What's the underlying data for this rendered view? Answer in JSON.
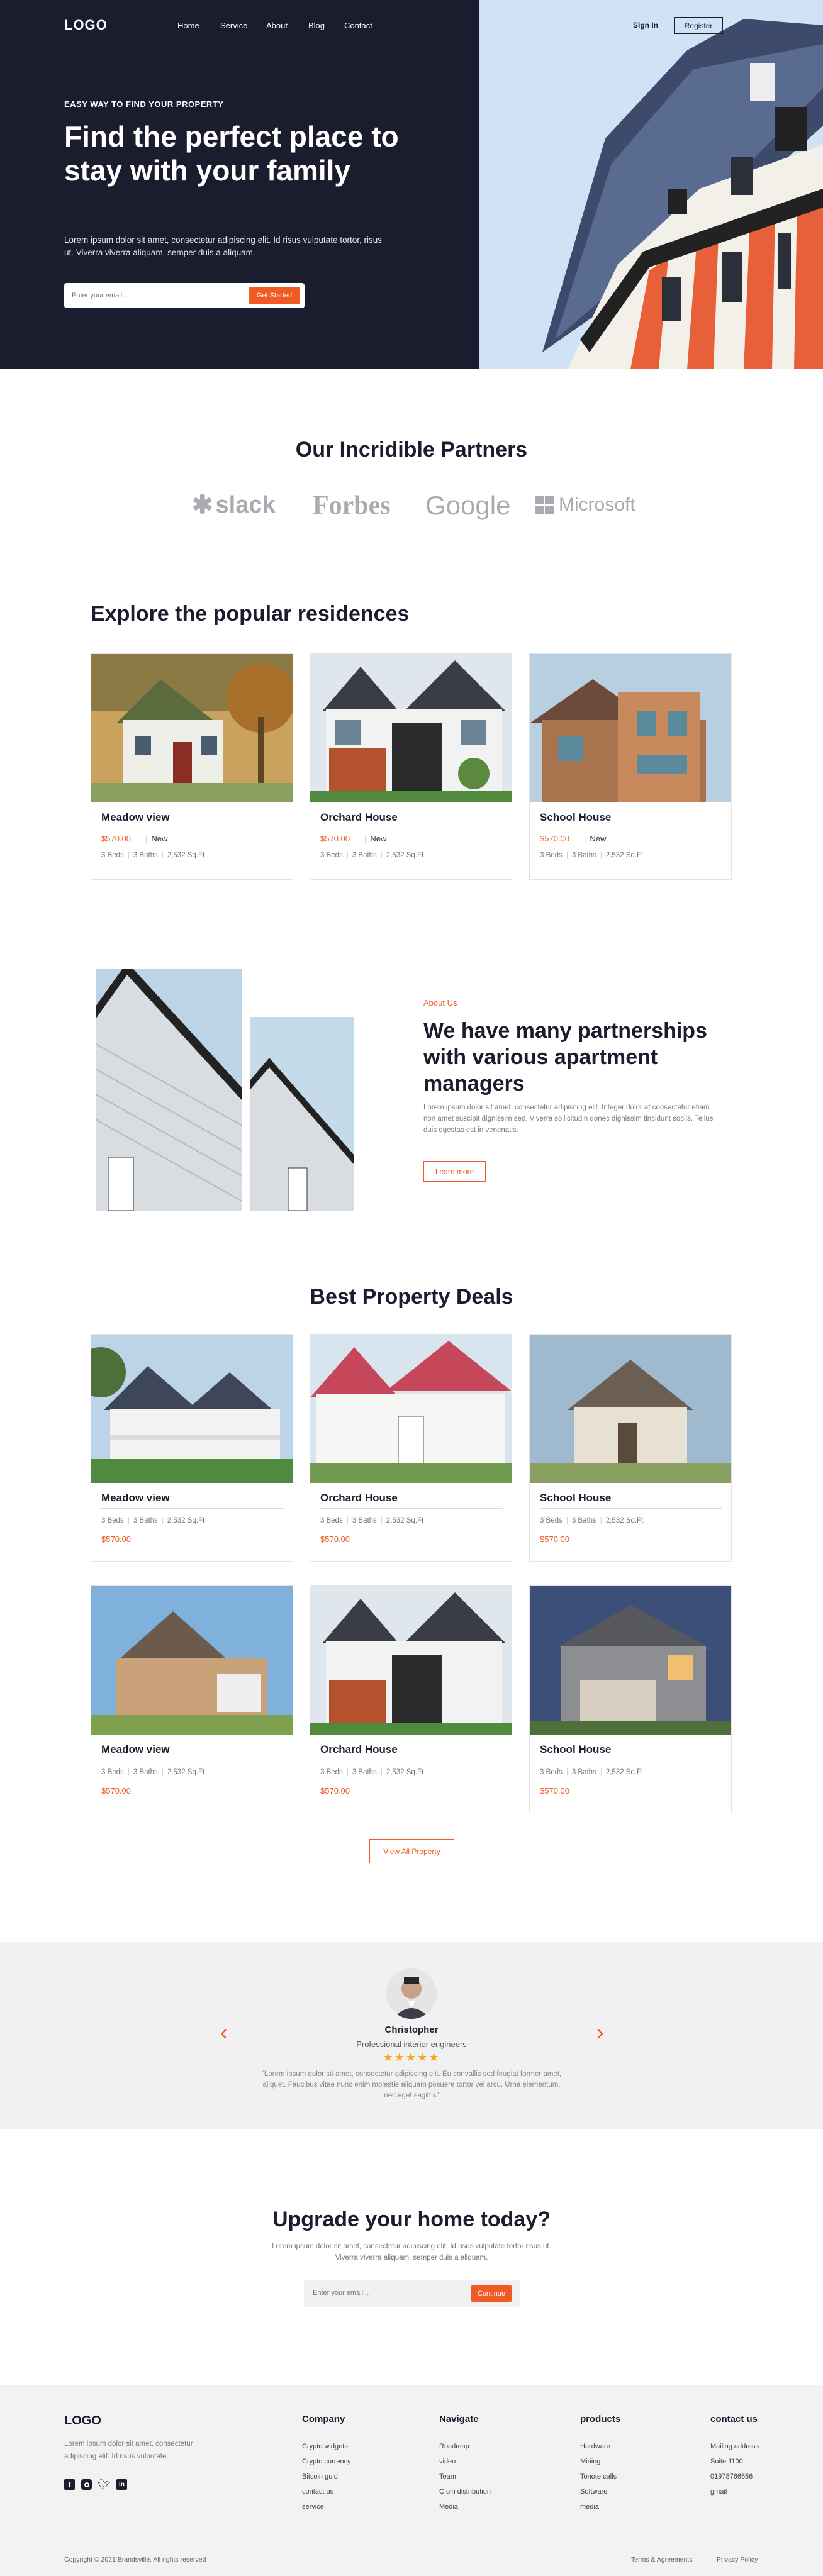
{
  "header": {
    "logo": "LOGO",
    "nav": [
      "Home",
      "Service",
      "About",
      "Blog",
      "Contact"
    ],
    "sign_in": "Sign In",
    "register": "Register"
  },
  "hero": {
    "eyebrow": "EASY WAY TO FIND YOUR PROPERTY",
    "title": "Find the perfect place to stay with your family",
    "text": "Lorem ipsum dolor sit amet, consectetur adipiscing elit. Id risus vulputate tortor, risus ut. Viverra viverra aliquam, semper duis a aliquam.",
    "email_placeholder": "Enter your email...",
    "cta": "Get Started"
  },
  "partners": {
    "title": "Our Incridible Partners",
    "logos": [
      "slack",
      "Forbes",
      "Google",
      "Microsoft"
    ]
  },
  "popular": {
    "title": "Explore the popular residences",
    "cards": [
      {
        "name": "Meadow view",
        "price": "$570.00",
        "tag": "New",
        "beds": "3 Beds",
        "baths": "3 Baths",
        "area": "2,532 Sq.Ft"
      },
      {
        "name": "Orchard House",
        "price": "$570.00",
        "tag": "New",
        "beds": "3 Beds",
        "baths": "3 Baths",
        "area": "2,532 Sq.Ft"
      },
      {
        "name": "School House",
        "price": "$570.00",
        "tag": "New",
        "beds": "3 Beds",
        "baths": "3 Baths",
        "area": "2,532 Sq.Ft"
      }
    ]
  },
  "about": {
    "label": "About Us",
    "title": "We have many partnerships with various apartment managers",
    "text": "Lorem ipsum dolor sit amet, consectetur adipiscing elit. Integer dolor at consectetur etiam non amet suscipit dignissim sed. Viverra sollicitudin donec dignissim tincidunt sociis. Tellus duis egestas est in venenatis.",
    "cta": "Learn more"
  },
  "deals": {
    "title": "Best Property Deals",
    "cards": [
      {
        "name": "Meadow view",
        "beds": "3 Beds",
        "baths": "3 Baths",
        "area": "2,532 Sq.Ft",
        "price": "$570.00"
      },
      {
        "name": "Orchard House",
        "beds": "3 Beds",
        "baths": "3 Baths",
        "area": "2,532 Sq.Ft",
        "price": "$570.00"
      },
      {
        "name": "School House",
        "beds": "3 Beds",
        "baths": "3 Baths",
        "area": "2,532 Sq.Ft",
        "price": "$570.00"
      },
      {
        "name": "Meadow view",
        "beds": "3 Beds",
        "baths": "3 Baths",
        "area": "2,532 Sq.Ft",
        "price": "$570.00"
      },
      {
        "name": "Orchard House",
        "beds": "3 Beds",
        "baths": "3 Baths",
        "area": "2,532 Sq.Ft",
        "price": "$570.00"
      },
      {
        "name": "School House",
        "beds": "3 Beds",
        "baths": "3 Baths",
        "area": "2,532 Sq.Ft",
        "price": "$570.00"
      }
    ],
    "view_all": "View All Property"
  },
  "testimonial": {
    "name": "Christopher",
    "role": "Professional interior engineers",
    "stars": "★★★★★",
    "rating": 5,
    "quote": "\"Lorem ipsum dolor sit amet, consectetur adipiscing elit. Eu convallis sed feugiat former amet, aliquet. Faucibus vitae nunc enim molestie aliquam posuere tortor vel arcu. Urna elementum, nec eget sagittis\""
  },
  "upgrade": {
    "title": "Upgrade your home today?",
    "text": "Lorem ipsum dolor sit amet, consectetur adipiscing elit. Id risus vulputate tortor risus ut. Viverra viverra aliquam, semper duis a aliquam.",
    "email_placeholder": "Enter your email...",
    "cta": "Continue"
  },
  "footer": {
    "logo": "LOGO",
    "tagline": "Lorem ipsum dolor sit amet, consectetur adipiscing elit. Id risus vulputate.",
    "columns": [
      {
        "title": "Company",
        "items": [
          "Crypto widgets",
          "Crypto currency",
          "Bitcoin guid",
          "contact us",
          "service"
        ]
      },
      {
        "title": "Navigate",
        "items": [
          "Roadmap",
          "video",
          "Team",
          "C oin distribution",
          "Media"
        ]
      },
      {
        "title": "products",
        "items": [
          "Hardware",
          "Mining",
          "Tonote calls",
          "Software",
          "media"
        ]
      },
      {
        "title": "contact us",
        "items": [
          "Mailing address",
          "Suite 1100",
          "01978766556",
          "gmail"
        ]
      }
    ],
    "copyright": "Copyright © 2021 Brandsville. All rights reserved",
    "terms": "Terms & Agreements",
    "privacy": "Privacy Policy"
  },
  "colors": {
    "accent": "#f15a24",
    "dark": "#1b1c2d",
    "sky": "#cfe2f6"
  }
}
